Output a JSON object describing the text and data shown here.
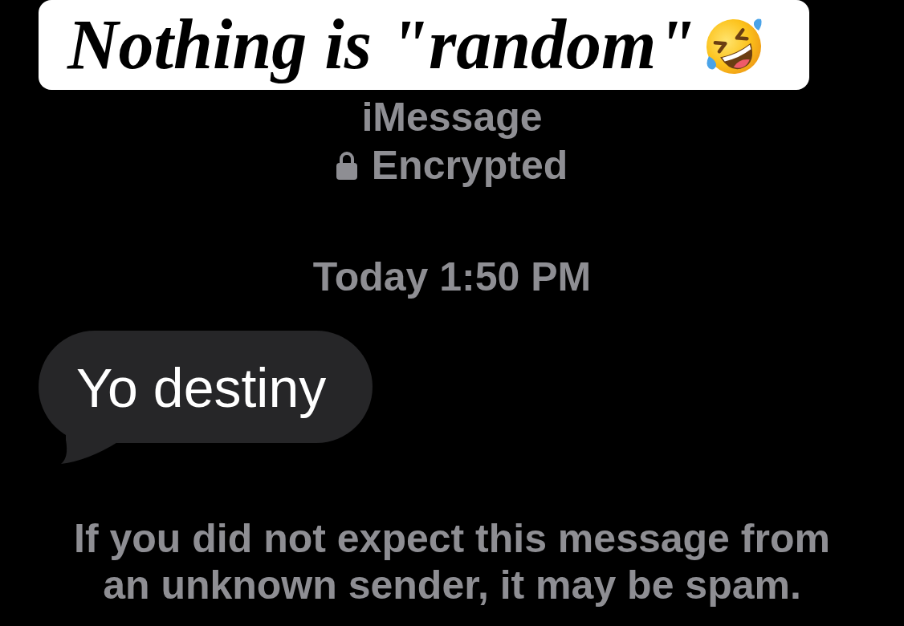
{
  "caption": {
    "text": "Nothing is \"random\""
  },
  "conversation": {
    "service": "iMessage",
    "encryption": "Encrypted",
    "timestamp": "Today 1:50 PM",
    "messages": [
      {
        "kind": "incoming",
        "text": "Yo destiny"
      }
    ],
    "spam_notice": "If you did not expect this message from an unknown sender, it may be spam."
  }
}
